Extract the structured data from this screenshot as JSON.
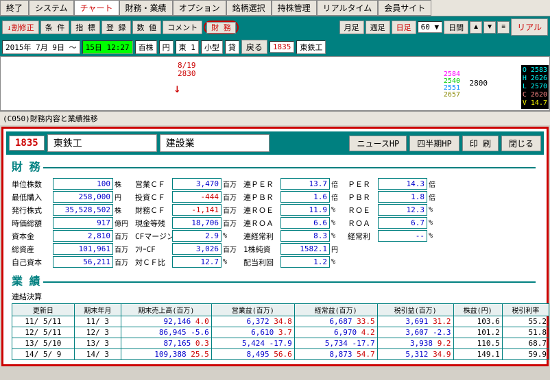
{
  "tabs": {
    "end": "終了",
    "system": "システム",
    "chart": "チャート",
    "finance": "財務・業績",
    "option": "オプション",
    "select": "銘柄選択",
    "hold": "持株管理",
    "realtime": "リアルタイム",
    "member": "会員サイト"
  },
  "toolbar": {
    "split": "↓割修正",
    "cond": "条 件",
    "ind": "指 標",
    "reg": "登 録",
    "num": "数 値",
    "comment": "コメント",
    "fin": "財 務",
    "month": "月足",
    "week": "週足",
    "day": "日足",
    "period_val": "60",
    "period_unit": "日間",
    "real": "リアル"
  },
  "datebar": {
    "date": "2015年 7月 9日 ～",
    "day": "15日",
    "time": "12:27",
    "unit": "百株",
    "yen": "円",
    "tokyo": "東 1",
    "small": "小型",
    "lend": "貸",
    "back": "戻る",
    "code": "1835",
    "name": "東鉄工"
  },
  "chart": {
    "date": "8/19",
    "price": "2830",
    "p1": "2584",
    "p2": "2540",
    "p3": "2551",
    "p4": "2657",
    "last": "2800"
  },
  "ohlc": {
    "O": "2583",
    "H": "2626",
    "L": "2570",
    "C": "2620",
    "V": "14.7"
  },
  "panel_title": "(C050)財務内容と業績推移",
  "header": {
    "code": "1835",
    "name": "東鉄工",
    "sector": "建設業",
    "news": "ニュースHP",
    "quarter": "四半期HP",
    "print": "印 刷",
    "close": "閉じる"
  },
  "sec_fin": "財 務",
  "sec_res": "業 績",
  "sub": "連結決算",
  "fin": {
    "r1": {
      "l1": "単位株数",
      "v1": "100",
      "u1": "株",
      "l2": "営業ＣＦ",
      "v2": "3,470",
      "u2": "百万",
      "l3": "連ＰＥＲ",
      "v3": "13.7",
      "u3": "倍",
      "l4": "ＰＥＲ",
      "v4": "14.3",
      "u4": "倍"
    },
    "r2": {
      "l1": "最低購入",
      "v1": "258,000",
      "u1": "円",
      "l2": "投資ＣＦ",
      "v2": "-444",
      "u2": "百万",
      "l3": "連ＰＢＲ",
      "v3": "1.6",
      "u3": "倍",
      "l4": "ＰＢＲ",
      "v4": "1.8",
      "u4": "倍"
    },
    "r3": {
      "l1": "発行株式",
      "v1": "35,528,502",
      "u1": "株",
      "l2": "財務ＣＦ",
      "v2": "-1,141",
      "u2": "百万",
      "l3": "連ＲＯＥ",
      "v3": "11.9",
      "u3": "%",
      "l4": "ＲＯＥ",
      "v4": "12.3",
      "u4": "%"
    },
    "r4": {
      "l1": "時価総額",
      "v1": "917",
      "u1": "億円",
      "l2": "現金等残",
      "v2": "18,706",
      "u2": "百万",
      "l3": "連ＲＯＡ",
      "v3": "6.6",
      "u3": "%",
      "l4": "ＲＯＡ",
      "v4": "6.7",
      "u4": "%"
    },
    "r5": {
      "l1": "資本金",
      "v1": "2,810",
      "u1": "百万",
      "l2": "CFマージン",
      "v2": "2.9",
      "u2": "%",
      "l3": "連経常利",
      "v3": "8.3",
      "u3": "%",
      "l4": "経常利",
      "v4": "--",
      "u4": "%"
    },
    "r6": {
      "l1": "総資産",
      "v1": "101,961",
      "u1": "百万",
      "l2": "ﾌﾘｰCF",
      "v2": "3,026",
      "u2": "百万",
      "l3": "1株純資",
      "v3": "1582.1",
      "u3": "円",
      "l4": "",
      "v4": "",
      "u4": ""
    },
    "r7": {
      "l1": "自己資本",
      "v1": "56,211",
      "u1": "百万",
      "l2": "対ＣＦ比",
      "v2": "12.7",
      "u2": "%",
      "l3": "配当利回",
      "v3": "1.2",
      "u3": "%",
      "l4": "",
      "v4": "",
      "u4": ""
    }
  },
  "chart_data": {
    "type": "table",
    "title": "業績 連結決算",
    "columns": [
      "更新日",
      "期末年月",
      "期末売上高(百万)",
      "営業益(百万)",
      "経常益(百万)",
      "税引益(百万)",
      "株益(円)",
      "税引利率"
    ],
    "rows": [
      {
        "update": "11/ 5/11",
        "term": "11/ 3",
        "sales": "92,146",
        "sales_pct": "4.0",
        "op": "6,372",
        "op_pct": "34.8",
        "ord": "6,687",
        "ord_pct": "33.5",
        "net": "3,691",
        "net_pct": "31.2",
        "eps": "103.6",
        "margin": "55.2"
      },
      {
        "update": "12/ 5/11",
        "term": "12/ 3",
        "sales": "86,945",
        "sales_pct": "-5.6",
        "op": "6,610",
        "op_pct": "3.7",
        "ord": "6,970",
        "ord_pct": "4.2",
        "net": "3,607",
        "net_pct": "-2.3",
        "eps": "101.2",
        "margin": "51.8"
      },
      {
        "update": "13/ 5/10",
        "term": "13/ 3",
        "sales": "87,165",
        "sales_pct": "0.3",
        "op": "5,424",
        "op_pct": "-17.9",
        "ord": "5,734",
        "ord_pct": "-17.7",
        "net": "3,938",
        "net_pct": "9.2",
        "eps": "110.5",
        "margin": "68.7"
      },
      {
        "update": "14/ 5/ 9",
        "term": "14/ 3",
        "sales": "109,388",
        "sales_pct": "25.5",
        "op": "8,495",
        "op_pct": "56.6",
        "ord": "8,873",
        "ord_pct": "54.7",
        "net": "5,312",
        "net_pct": "34.9",
        "eps": "149.1",
        "margin": "59.9"
      }
    ]
  }
}
